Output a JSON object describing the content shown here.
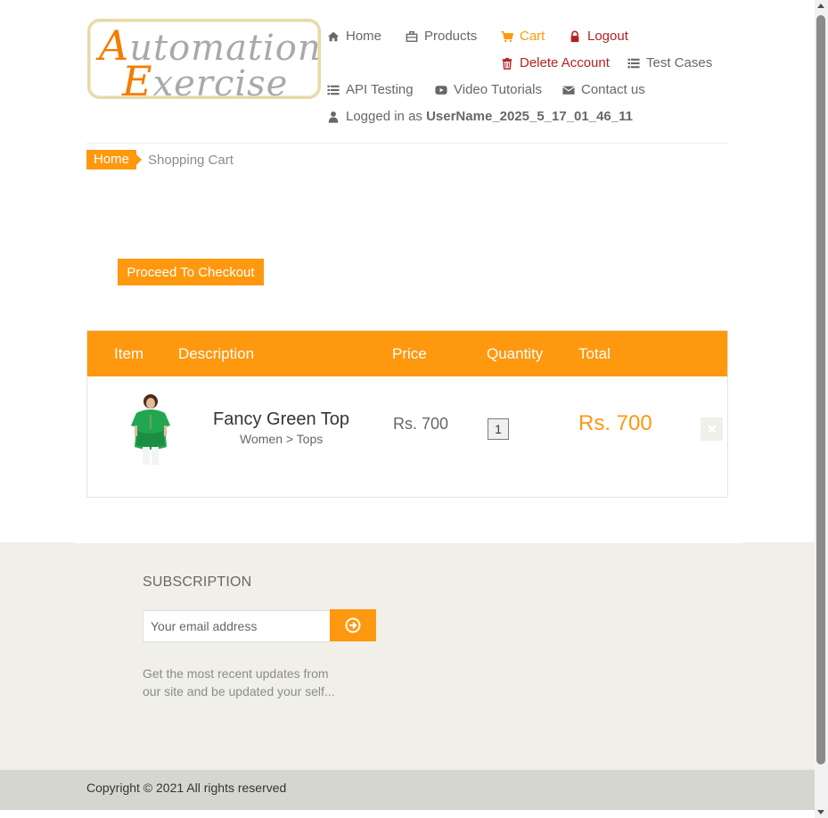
{
  "logo": {
    "line1_cap": "A",
    "line1_rest": "utomation",
    "line2_cap": "E",
    "line2_rest": "xercise"
  },
  "nav": {
    "home": "Home",
    "products": "Products",
    "cart": "Cart",
    "logout": "Logout",
    "delete_account": "Delete Account",
    "test_cases": "Test Cases",
    "api_testing": "API Testing",
    "video_tutorials": "Video Tutorials",
    "contact_us": "Contact us",
    "logged_in_prefix": "Logged in as",
    "username": "UserName_2025_5_17_01_46_11"
  },
  "breadcrumb": {
    "home": "Home",
    "current": "Shopping Cart"
  },
  "checkout_button": "Proceed To Checkout",
  "cart": {
    "headers": {
      "item": "Item",
      "description": "Description",
      "price": "Price",
      "quantity": "Quantity",
      "total": "Total"
    },
    "rows": [
      {
        "name": "Fancy Green Top",
        "category": "Women > Tops",
        "price": "Rs. 700",
        "quantity": "1",
        "total": "Rs. 700"
      }
    ]
  },
  "subscription": {
    "title": "SUBSCRIPTION",
    "placeholder": "Your email address",
    "text_line1": "Get the most recent updates from",
    "text_line2": "our site and be updated your self..."
  },
  "footer": {
    "copyright": "Copyright © 2021 All rights reserved"
  },
  "colors": {
    "accent": "#fe980f",
    "danger": "#b22222",
    "footer_bg": "#f0f0e9",
    "footer_bottom": "#d6d6d0"
  },
  "icons": [
    "home-icon",
    "products-icon",
    "cart-icon",
    "lock-icon",
    "trash-icon",
    "list-icon",
    "youtube-icon",
    "envelope-icon",
    "user-icon",
    "close-icon",
    "arrow-circle-right-icon"
  ]
}
